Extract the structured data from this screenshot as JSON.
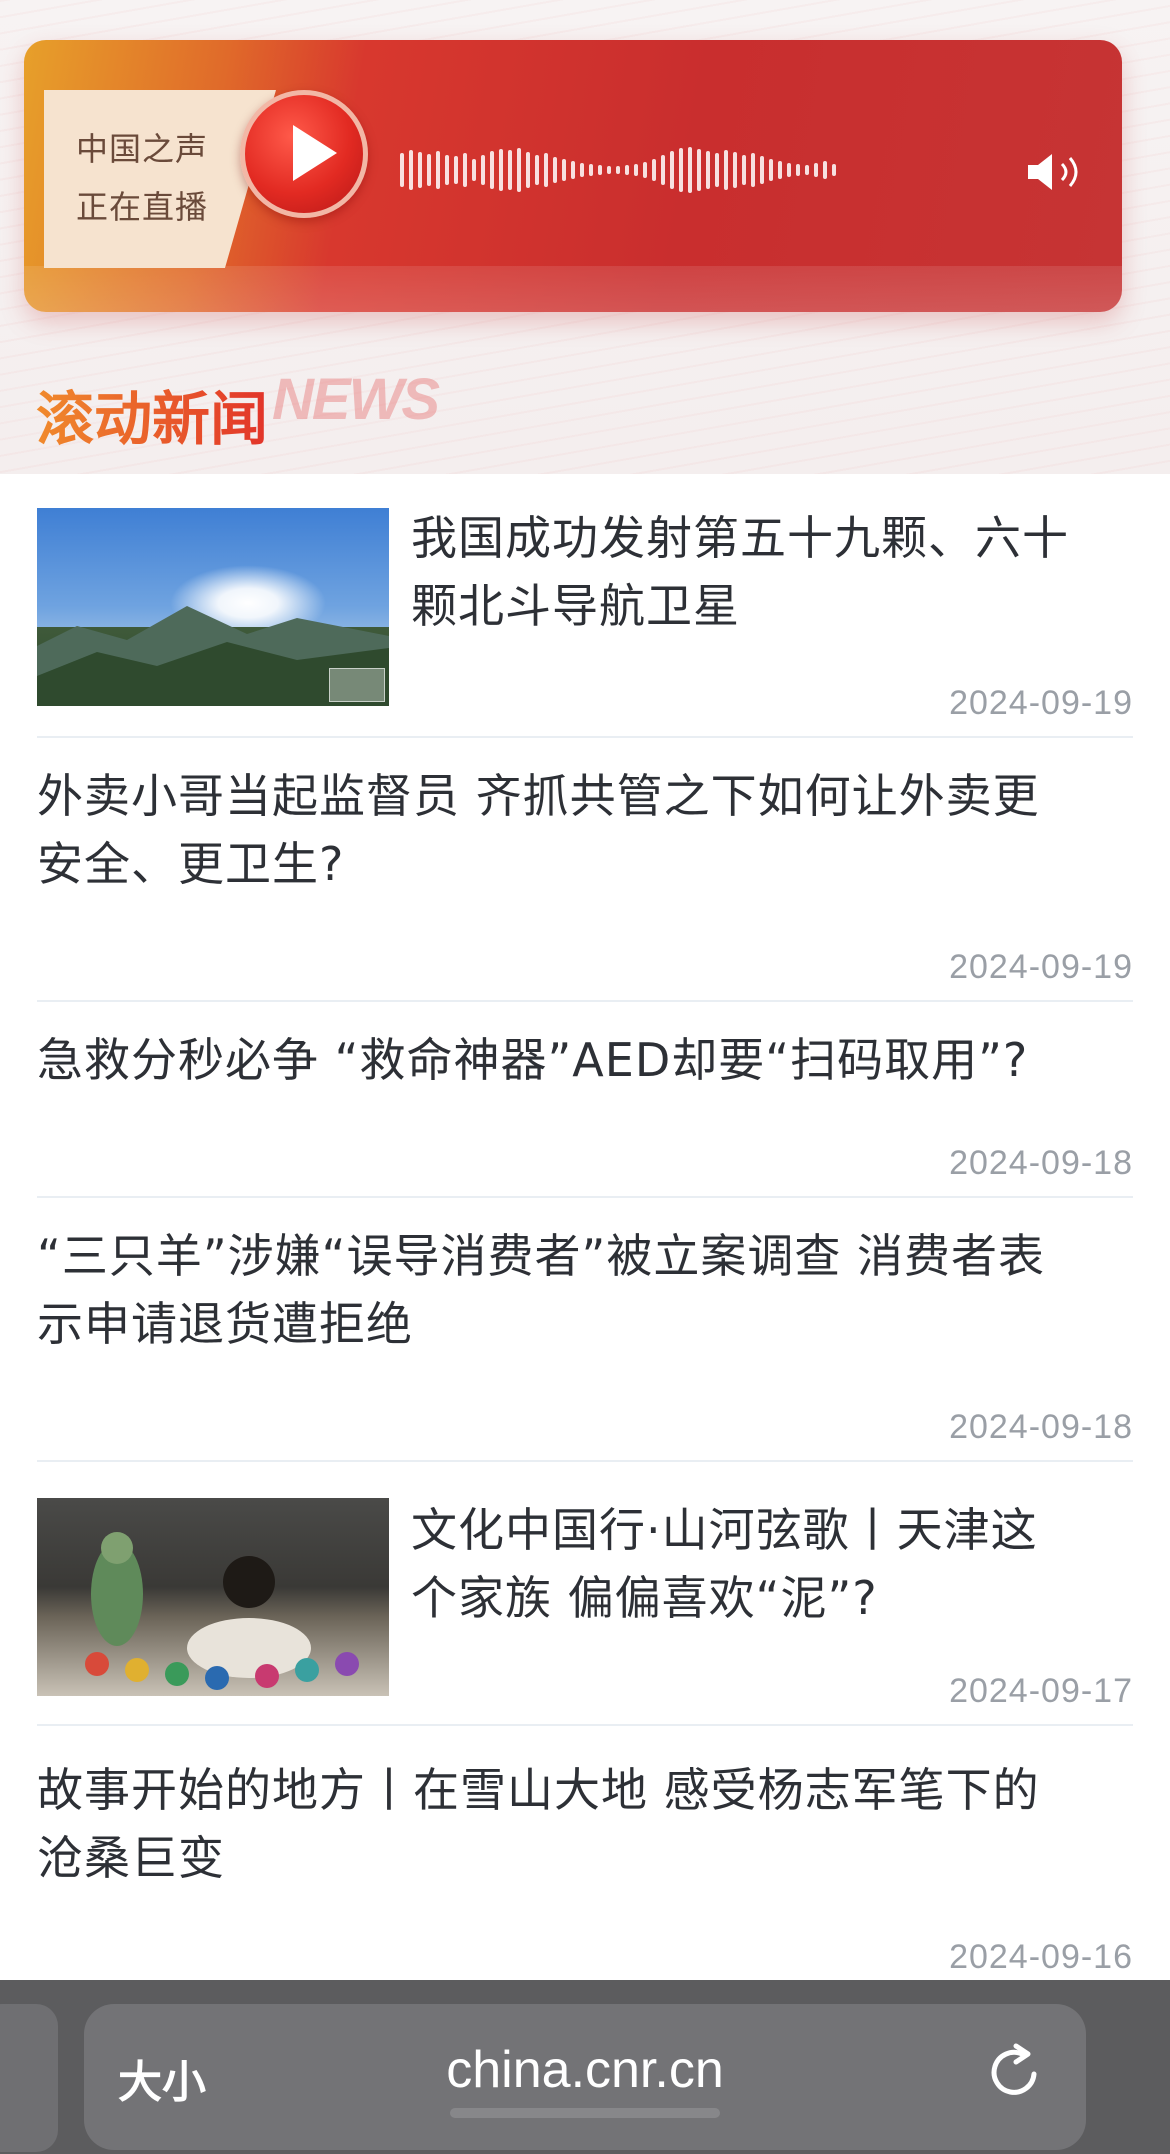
{
  "radio": {
    "line1": "中国之声",
    "line2": "正在直播",
    "play_icon": "play-icon",
    "speaker_icon": "speaker-icon"
  },
  "section": {
    "title": "滚动新闻",
    "watermark": "NEWS"
  },
  "news": [
    {
      "title_lines": [
        "我国成功发射第五十九颗、六十",
        "颗北斗导航卫星"
      ],
      "date": "2024-09-19",
      "has_image": true
    },
    {
      "title_lines": [
        "外卖小哥当起监督员 齐抓共管之下如何让外卖更",
        "安全、更卫生?"
      ],
      "date": "2024-09-19",
      "has_image": false
    },
    {
      "title_lines": [
        "急救分秒必争 “救命神器”AED却要“扫码取用”?"
      ],
      "date": "2024-09-18",
      "has_image": false
    },
    {
      "title_lines": [
        "“三只羊”涉嫌“误导消费者”被立案调查 消费者表",
        "示申请退货遭拒绝"
      ],
      "date": "2024-09-18",
      "has_image": false
    },
    {
      "title_lines": [
        "文化中国行·山河弦歌丨天津这",
        "个家族 偏偏喜欢“泥”?"
      ],
      "date": "2024-09-17",
      "has_image": true
    },
    {
      "title_lines": [
        "故事开始的地方丨在雪山大地 感受杨志军笔下的",
        "沧桑巨变"
      ],
      "date": "2024-09-16",
      "has_image": false
    }
  ],
  "browser": {
    "size_label": "大小",
    "url": "china.cnr.cn",
    "reload_icon": "reload-icon"
  },
  "colors": {
    "accent_red": "#c92e2e",
    "title_gradient_start": "#f08a2c",
    "title_gradient_end": "#e2342a",
    "date_gray": "#9a9fa6"
  }
}
